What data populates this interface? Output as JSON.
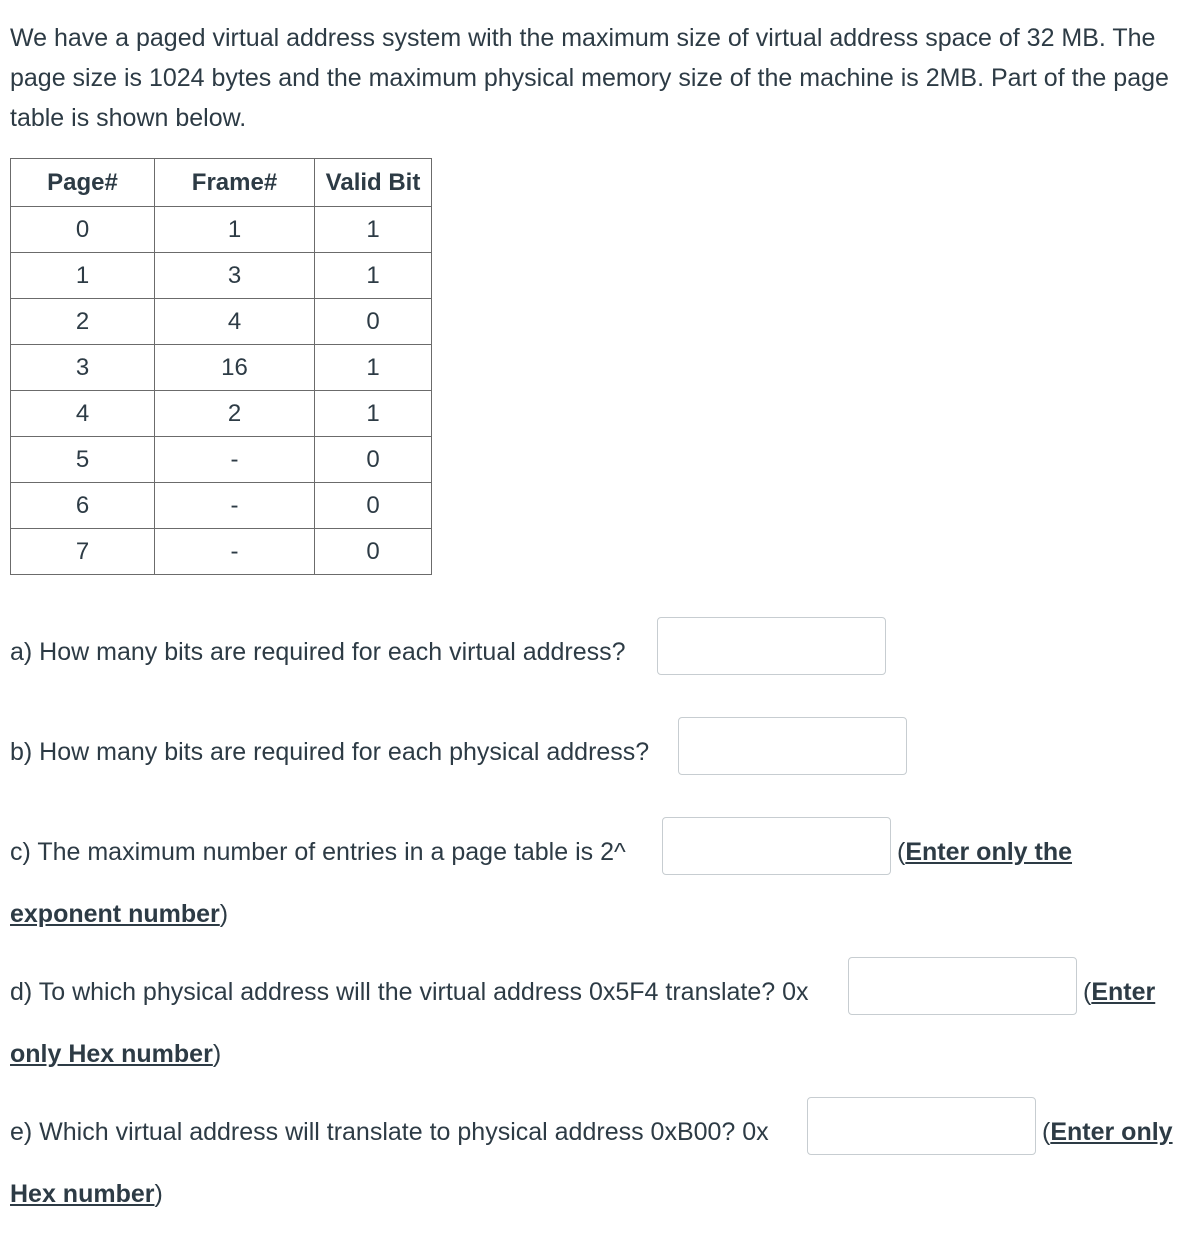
{
  "intro": "We have a paged virtual address system with the maximum size of virtual address space of 32 MB. The page size is 1024 bytes and the maximum physical memory size of the machine is 2MB. Part of the page table is shown below.",
  "page_table": {
    "headers": [
      "Page#",
      "Frame#",
      "Valid Bit"
    ],
    "rows": [
      [
        "0",
        "1",
        "1"
      ],
      [
        "1",
        "3",
        "1"
      ],
      [
        "2",
        "4",
        "0"
      ],
      [
        "3",
        "16",
        "1"
      ],
      [
        "4",
        "2",
        "1"
      ],
      [
        "5",
        "-",
        "0"
      ],
      [
        "6",
        "-",
        "0"
      ],
      [
        "7",
        "-",
        "0"
      ]
    ]
  },
  "questions": {
    "a": {
      "text": "a) How many bits are required for each virtual address?",
      "value": ""
    },
    "b": {
      "text": "b) How many bits are required for each physical address?",
      "value": ""
    },
    "c": {
      "text": "c) The maximum number of entries in a page table is 2^",
      "value": "",
      "hint_open": "(",
      "hint_line1": "Enter only the",
      "hint_line2": "exponent number",
      "hint_close": ")"
    },
    "d": {
      "text": "d) To which physical address will the virtual address 0x5F4 translate? 0x",
      "value": "",
      "hint_open": "(",
      "hint_line1": "Enter",
      "hint_line2": "only Hex number",
      "hint_close": ")"
    },
    "e": {
      "text": "e) Which virtual address will translate to physical address 0xB00? 0x",
      "value": "",
      "hint_open": "(",
      "hint_line1": "Enter only",
      "hint_line2": "Hex number",
      "hint_close": ")"
    }
  }
}
